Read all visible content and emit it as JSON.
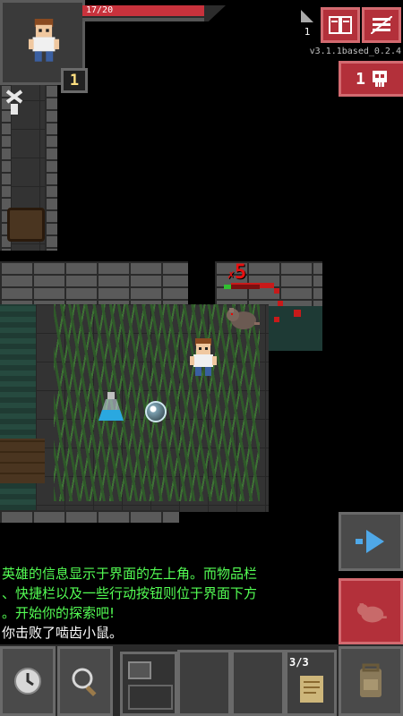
{
  "hero": {
    "hp_text": "17/20",
    "hp_fraction": 0.85,
    "level": "1"
  },
  "top_right": {
    "depth": "1",
    "version": "v3.1.1based_0.2.4",
    "danger_count": "1"
  },
  "map": {
    "damage_popup": "5",
    "enemy_hp_fraction": 0.2
  },
  "log": {
    "lines": [
      "英雄的信息显示于界面的左上角。而物品栏",
      "、快捷栏以及一些行动按钮则位于界面下方",
      "。开始你的探索吧!",
      "你击败了啮齿小鼠。"
    ]
  },
  "quickslot": {
    "count": "3/3"
  },
  "colors": {
    "hp_bar": "#c8323c",
    "log_text": "#54ff54",
    "danger_badge": "#b3303a",
    "accent_button": "#b3303a"
  }
}
